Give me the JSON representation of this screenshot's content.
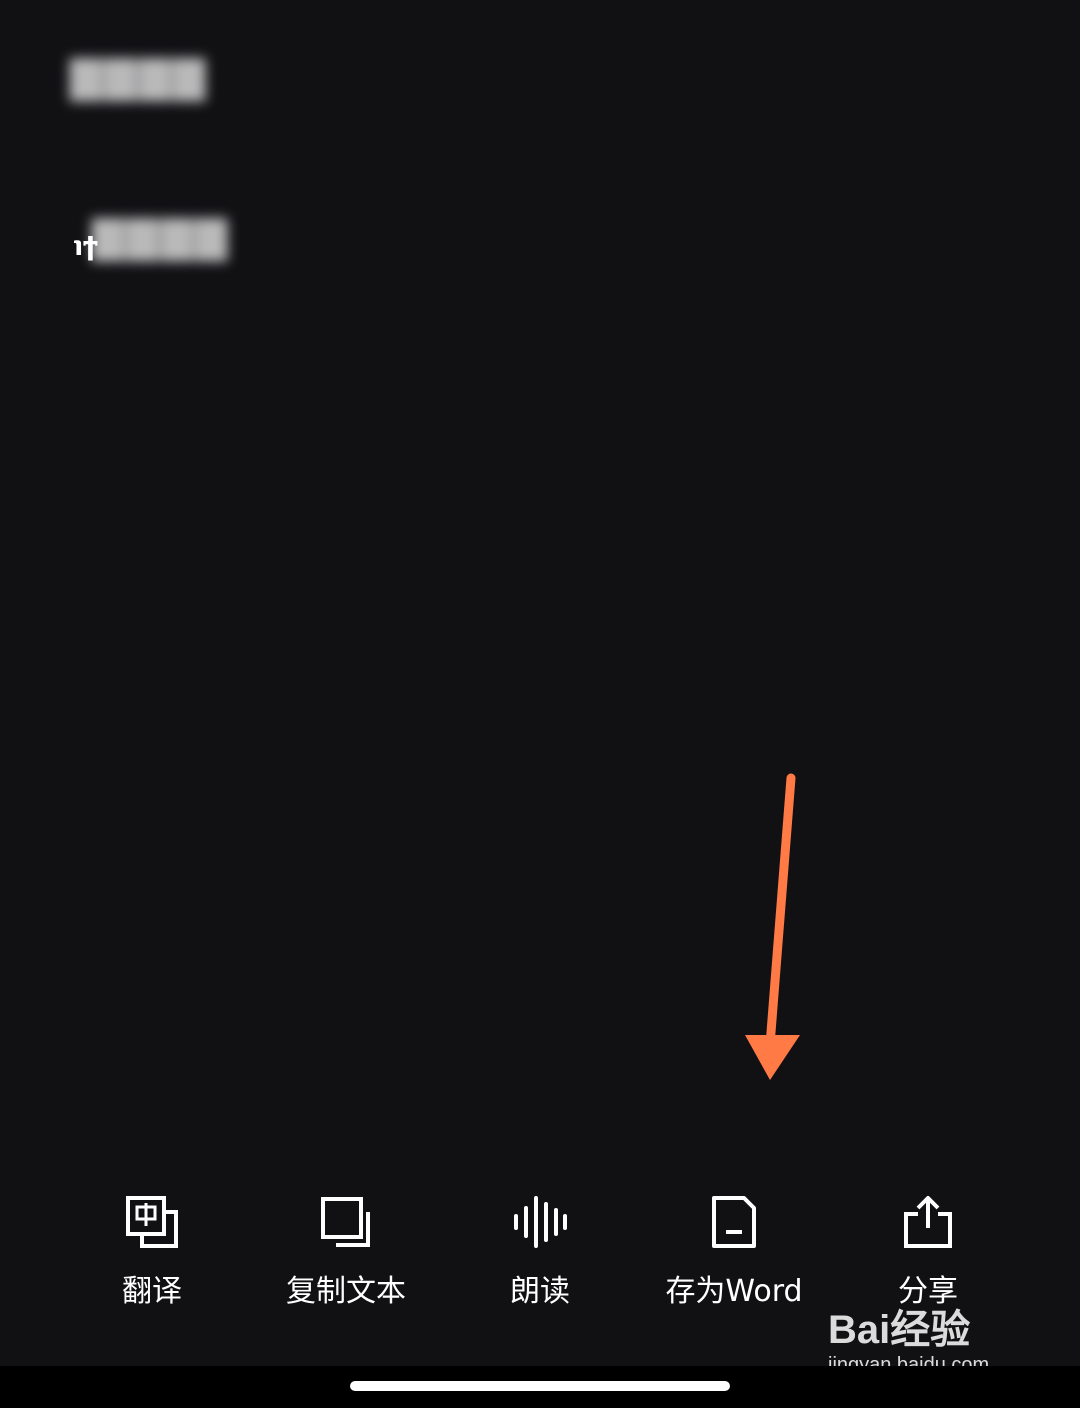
{
  "content": {
    "cursor_glyph": "℩ϯ"
  },
  "toolbar": {
    "items": [
      {
        "name": "translate",
        "label": "翻译",
        "icon": "translate-icon"
      },
      {
        "name": "copy-text",
        "label": "复制文本",
        "icon": "copy-icon"
      },
      {
        "name": "read-aloud",
        "label": "朗读",
        "icon": "audio-wave-icon"
      },
      {
        "name": "save-word",
        "label": "存为Word",
        "icon": "document-icon"
      },
      {
        "name": "share",
        "label": "分享",
        "icon": "share-icon"
      }
    ]
  },
  "annotation": {
    "arrow_color": "#FF7A45"
  },
  "watermark": {
    "brand": "Bai经验",
    "url": "jingyan.baidu.com"
  },
  "colors": {
    "background": "#111114",
    "icon": "#FFFFFF",
    "label": "#FFFFFF"
  }
}
